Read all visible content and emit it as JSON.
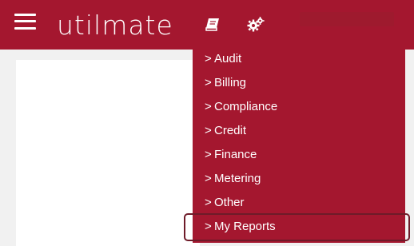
{
  "app": {
    "logo_text": "utilmate"
  },
  "header": {
    "icons": [
      "menu-icon",
      "book-icon",
      "gears-icon"
    ]
  },
  "menu": {
    "items": [
      {
        "chevron": ">",
        "label": "Audit"
      },
      {
        "chevron": ">",
        "label": "Billing"
      },
      {
        "chevron": ">",
        "label": "Compliance"
      },
      {
        "chevron": ">",
        "label": "Credit"
      },
      {
        "chevron": ">",
        "label": "Finance"
      },
      {
        "chevron": ">",
        "label": "Metering"
      },
      {
        "chevron": ">",
        "label": "Other"
      },
      {
        "chevron": ">",
        "label": "My Reports"
      }
    ]
  },
  "colors": {
    "brand": "#a4172f",
    "highlight_border": "#6e1b29"
  }
}
